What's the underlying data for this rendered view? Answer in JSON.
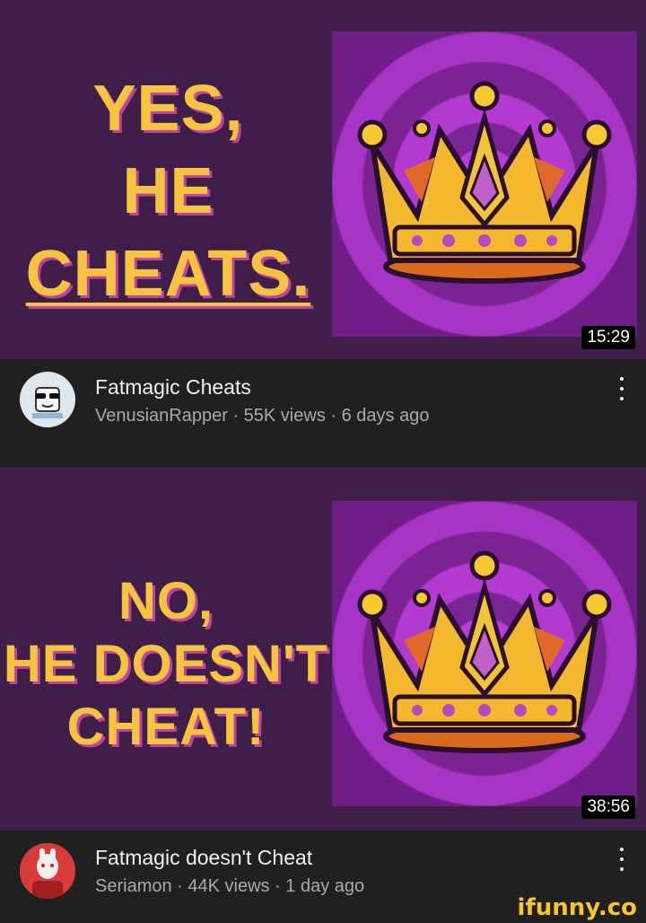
{
  "videos": [
    {
      "headline_lines": [
        "YES,",
        "HE",
        "CHEATS."
      ],
      "duration": "15:29",
      "title": "Fatmagic Cheats",
      "subtitle": "VenusianRapper · 55K views · 6 days ago",
      "thumbnail_icon": "crown-icon",
      "avatar_icon": "channel-avatar"
    },
    {
      "headline_lines": [
        "NO,",
        "HE DOESN'T",
        "CHEAT!"
      ],
      "duration": "38:56",
      "title": "Fatmagic doesn't Cheat",
      "subtitle": "Seriamon · 44K views · 1 day ago",
      "thumbnail_icon": "crown-icon",
      "avatar_icon": "channel-avatar"
    }
  ],
  "watermark": "ifunny.co",
  "colors": {
    "thumbnail_bg": "#3f1f4a",
    "headline": "#f7c440",
    "app_bg": "#202020",
    "subtitle": "#aaaaaa"
  }
}
